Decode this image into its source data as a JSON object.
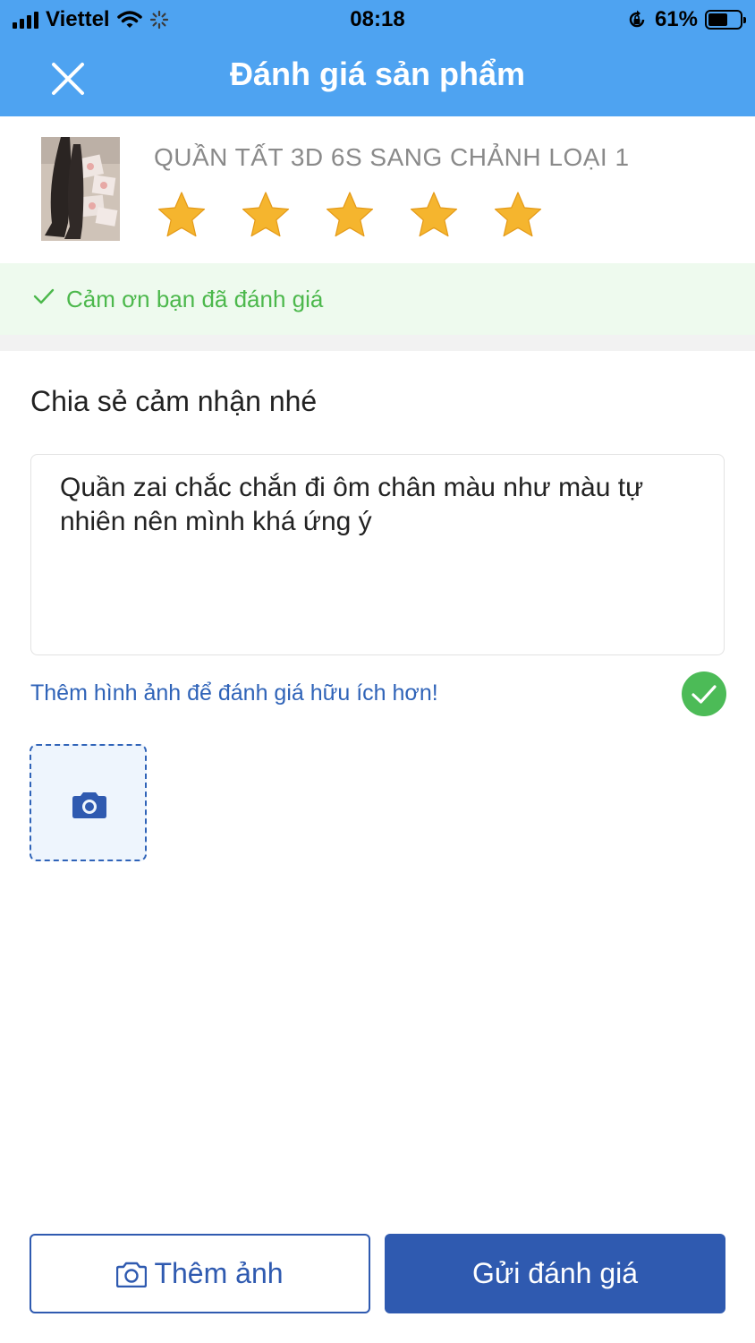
{
  "status_bar": {
    "carrier": "Viettel",
    "time": "08:18",
    "battery": "61%",
    "battery_level": 0.61
  },
  "header": {
    "title": "Đánh giá sản phẩm",
    "close_icon": "close-icon",
    "background": "#4ea3f1"
  },
  "product": {
    "name": "QUẦN TẤT 3D 6S SANG CHẢNH LOẠI 1",
    "rating": 5,
    "max_rating": 5,
    "star_color": "#f5b52e"
  },
  "thanks": {
    "text": "Cảm ơn bạn đã đánh giá",
    "color": "#4cb84c"
  },
  "review": {
    "section_title": "Chia sẻ cảm nhận nhé",
    "text": "Quần zai chắc chắn đi ôm chân màu như màu tự nhiên nên mình khá ứng ý"
  },
  "photo_hint": {
    "text": "Thêm hình ảnh để đánh giá hữu ích hơn!",
    "status_icon": "check-circle-icon",
    "status_color": "#4cbb57"
  },
  "actions": {
    "add_photo_label": "Thêm ảnh",
    "submit_label": "Gửi đánh giá",
    "primary_color": "#2f5ab0"
  }
}
